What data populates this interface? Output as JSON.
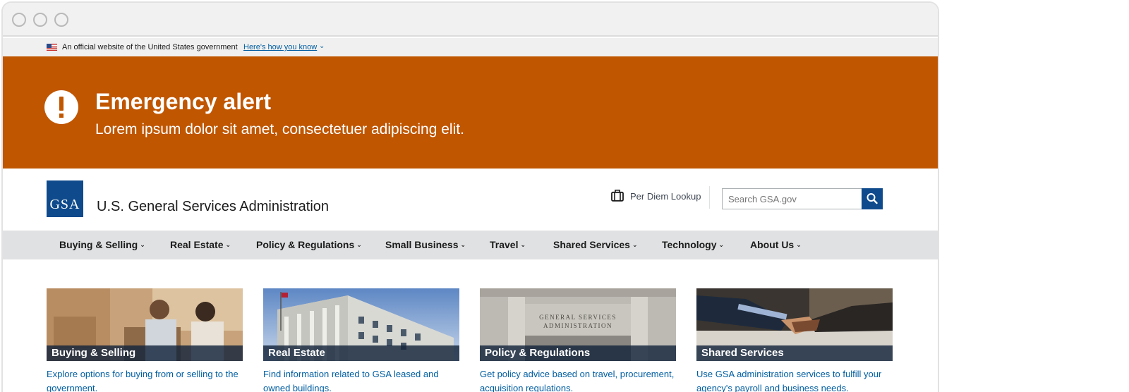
{
  "gov_banner": {
    "text": "An official website of the United States government",
    "link": "Here's how you know"
  },
  "alert": {
    "title": "Emergency alert",
    "body": "Lorem ipsum dolor sit amet, consectetuer adipiscing elit."
  },
  "header": {
    "logo": "GSA",
    "agency": "U.S. General Services Administration",
    "per_diem": "Per Diem Lookup",
    "search_placeholder": "Search GSA.gov"
  },
  "nav": [
    {
      "label": "Buying & Selling"
    },
    {
      "label": "Real Estate"
    },
    {
      "label": "Policy & Regulations"
    },
    {
      "label": "Small Business"
    },
    {
      "label": "Travel"
    },
    {
      "label": "Shared Services"
    },
    {
      "label": "Technology"
    },
    {
      "label": "About Us"
    }
  ],
  "cards": [
    {
      "title": "Buying & Selling",
      "description": "Explore options for buying from or selling to the government."
    },
    {
      "title": "Real Estate",
      "description": "Find information related to GSA leased and owned buildings."
    },
    {
      "title": "Policy & Regulations",
      "description": "Get policy advice based on travel, procurement, acquisition regulations."
    },
    {
      "title": "Shared Services",
      "description": "Use GSA administration services to fulfill your agency's payroll and business needs."
    }
  ],
  "colors": {
    "alert": "#c05600",
    "brand": "#0e4a8c",
    "link": "#005ea2",
    "nav_bg": "#dfe1e2"
  }
}
